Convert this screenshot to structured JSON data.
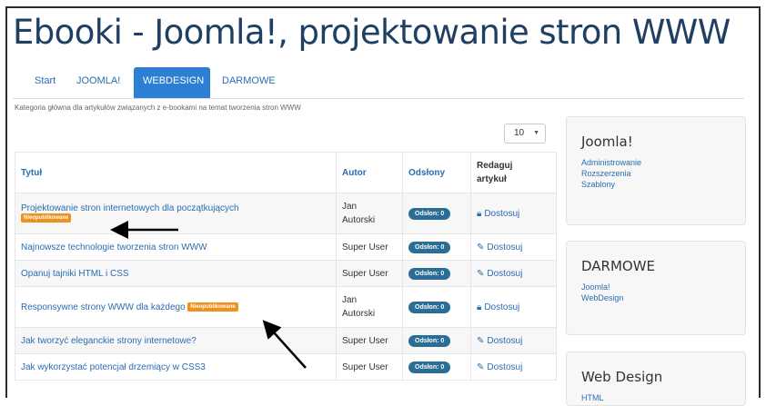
{
  "page": {
    "title": "Ebooki - Joomla!, projektowanie stron WWW",
    "tabs": [
      {
        "label": "Start",
        "active": false
      },
      {
        "label": "JOOMLA!",
        "active": false
      },
      {
        "label": "WEBDESIGN",
        "active": true
      },
      {
        "label": "DARMOWE",
        "active": false
      }
    ],
    "description": "Kategoria główna dla artykułów związanych z e-bookami na temat tworzenia stron WWW",
    "per_page": "10"
  },
  "table": {
    "headers": {
      "title": "Tytuł",
      "author": "Autor",
      "hits": "Odsłony",
      "edit_line1": "Redaguj",
      "edit_line2": "artykuł"
    },
    "rows": [
      {
        "title": "Projektowanie stron internetowych dla początkujących",
        "author1": "Jan",
        "author2": "Autorski",
        "hits": "Odsłon: 0",
        "edit": "Dostosuj",
        "badge": "Nieopublikowane",
        "locked": true
      },
      {
        "title": "Najnowsze technologie tworzenia stron WWW",
        "author1": "Super User",
        "author2": "",
        "hits": "Odsłon: 0",
        "edit": "Dostosuj",
        "badge": "",
        "locked": false
      },
      {
        "title": "Opanuj tajniki HTML i CSS",
        "author1": "Super User",
        "author2": "",
        "hits": "Odsłon: 0",
        "edit": "Dostosuj",
        "badge": "",
        "locked": false
      },
      {
        "title": "Responsywne strony WWW dla każdego",
        "author1": "Jan",
        "author2": "Autorski",
        "hits": "Odsłon: 0",
        "edit": "Dostosuj",
        "badge": "Nieopublikowane",
        "locked": true
      },
      {
        "title": "Jak tworzyć eleganckie strony internetowe?",
        "author1": "Super User",
        "author2": "",
        "hits": "Odsłon: 0",
        "edit": "Dostosuj",
        "badge": "",
        "locked": false
      },
      {
        "title": "Jak wykorzystać potencjał drzemiący w CSS3",
        "author1": "Super User",
        "author2": "",
        "hits": "Odsłon: 0",
        "edit": "Dostosuj",
        "badge": "",
        "locked": false
      }
    ]
  },
  "sidebar": {
    "joomla": {
      "title": "Joomla!",
      "links": [
        "Administrowanie",
        "Rozszerzenia",
        "Szablony"
      ]
    },
    "darmowe": {
      "title": "DARMOWE",
      "links": [
        "Joomla!",
        "WebDesign"
      ]
    },
    "webdesign": {
      "title": "Web Design",
      "links": [
        "HTML"
      ]
    }
  },
  "colors": {
    "accent": "#2d7fd4",
    "title": "#1f3f63",
    "badge_unpublished": "#f0911e",
    "hits_badge": "#2a6d96"
  }
}
